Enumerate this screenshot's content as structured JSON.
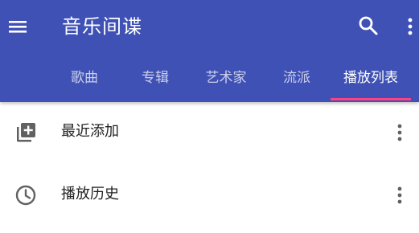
{
  "appbar": {
    "title": "音乐间谍",
    "menu_icon": "hamburger-menu-icon",
    "search_icon": "search-icon",
    "overflow_icon": "more-vert-icon",
    "background_color": "#3f51b5",
    "accent_color": "#ff4081"
  },
  "tabs": [
    {
      "label": "歌曲",
      "active": false
    },
    {
      "label": "专辑",
      "active": false
    },
    {
      "label": "艺术家",
      "active": false
    },
    {
      "label": "流派",
      "active": false
    },
    {
      "label": "播放列表",
      "active": true
    }
  ],
  "playlists": [
    {
      "label": "最近添加",
      "icon": "library-add-icon",
      "more_icon": "more-vert-icon"
    },
    {
      "label": "播放历史",
      "icon": "history-icon",
      "more_icon": "more-vert-icon"
    }
  ]
}
